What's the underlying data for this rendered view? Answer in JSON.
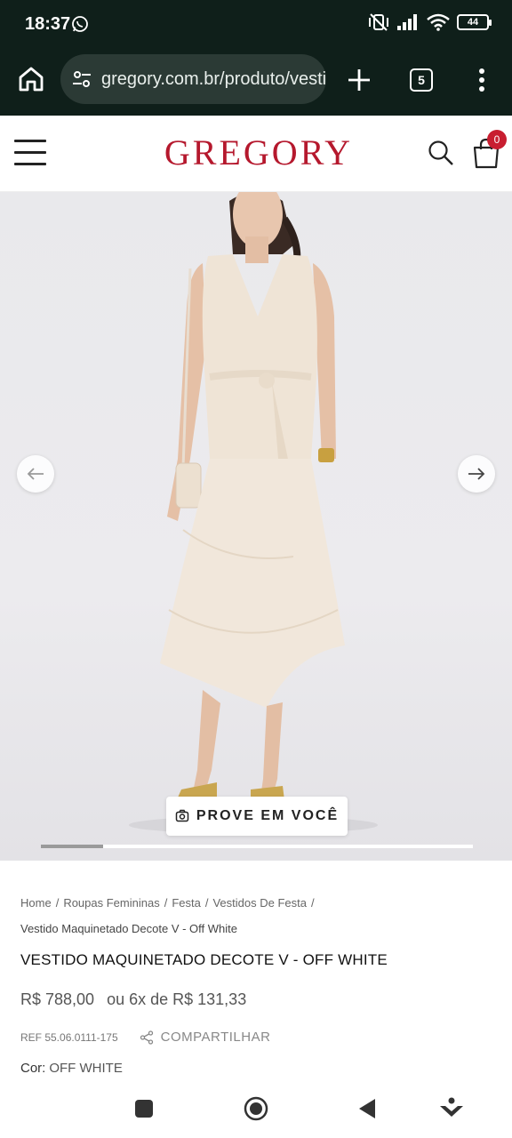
{
  "status_bar": {
    "time": "18:37",
    "battery": "44"
  },
  "browser": {
    "url": "gregory.com.br/produto/vestido-maquinetado",
    "tab_count": "5"
  },
  "header": {
    "logo": "GREGORY",
    "cart_count": "0",
    "brand_color": "#b5182d"
  },
  "gallery": {
    "try_on_label": "PROVE EM VOCÊ",
    "progress_fraction": 0.145
  },
  "breadcrumb": {
    "items": [
      "Home",
      "Roupas Femininas",
      "Festa",
      "Vestidos De Festa"
    ],
    "separator": "/",
    "current": "Vestido Maquinetado Decote V - Off White"
  },
  "product": {
    "title": "VESTIDO MAQUINETADO DECOTE V - OFF WHITE",
    "price": "R$ 788,00",
    "installments": "ou 6x de R$ 131,33",
    "ref": "REF 55.06.0111-175",
    "share_label": "COMPARTILHAR",
    "color_label": "Cor:",
    "color_value": "OFF WHITE"
  },
  "icons": {
    "home": "home-icon",
    "site_settings": "tune-icon",
    "new_tab": "plus-icon",
    "more": "more-vert-icon",
    "menu": "hamburger-icon",
    "search": "search-icon",
    "cart": "shopping-bag-icon",
    "prev": "arrow-left-icon",
    "next": "arrow-right-icon",
    "camera": "camera-icon",
    "share": "share-icon"
  }
}
